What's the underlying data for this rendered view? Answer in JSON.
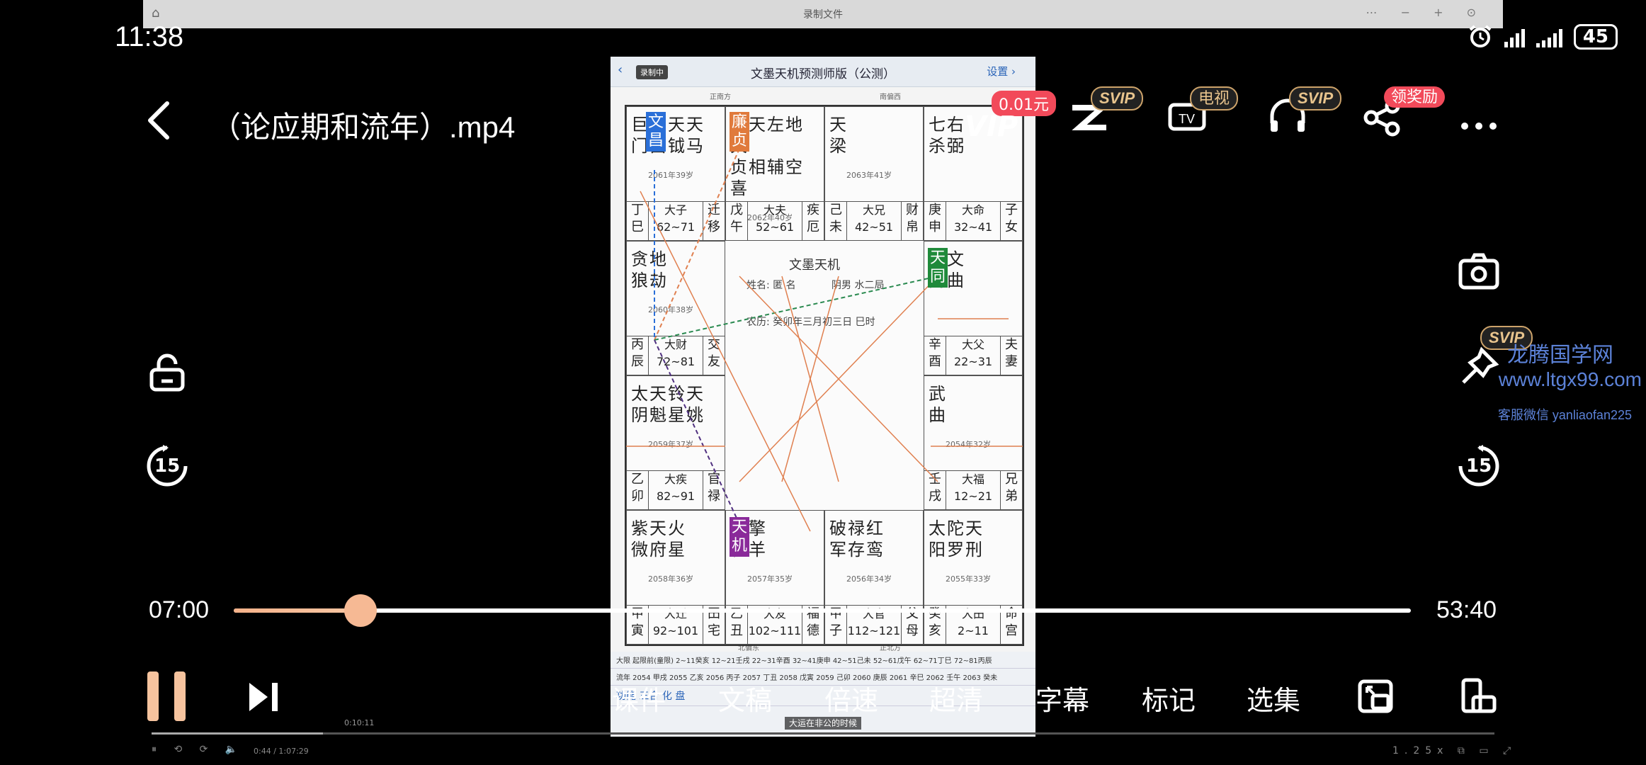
{
  "recorder": {
    "title": "录制文件",
    "home_icon": "⌂",
    "controls": "⋯ − + ⊙",
    "mini_time": "0:10:11",
    "bottom_left": "⏸ ⟲ ⟳ 🔈",
    "bottom_time": "0:44 / 1:07:29",
    "bottom_right": "1.25x ⧉ ▭ ⤢"
  },
  "status_bar": {
    "time": "11:38",
    "battery": "45"
  },
  "header": {
    "title": "（论应期和流年）.mp4"
  },
  "top_actions": {
    "price_badge": "0.01元",
    "vip_text": "VIP",
    "items": [
      {
        "name": "z-button",
        "badge": "SVIP"
      },
      {
        "name": "tv-button",
        "badge": "电视"
      },
      {
        "name": "audio-button",
        "badge": "SVIP"
      },
      {
        "name": "share-button",
        "badge": "领奖励"
      },
      {
        "name": "more-button",
        "badge": ""
      }
    ]
  },
  "side_controls": {
    "left_skip": "15",
    "right_skip": "15",
    "pin_badge": "SVIP"
  },
  "watermark": {
    "line1": "龙腾国学网",
    "line2": "www.ltgx99.com",
    "line3": "客服微信 yanliaofan225"
  },
  "player": {
    "current_time": "07:00",
    "total_time": "53:40",
    "progress": 0.108
  },
  "bottom_bar": {
    "items": [
      "课件",
      "文稿",
      "倍速",
      "超清",
      "字幕",
      "标记",
      "选集"
    ]
  },
  "video": {
    "back": "‹",
    "rec_tag": "录制中",
    "title": "文墨天机预测师版（公测）",
    "settings": "设置 ›",
    "center_title": "文墨天机",
    "center_name": "姓名: 匿 名",
    "center_gender": "阴男 水二局",
    "center_date": "农历: 癸卯年三月初三日 巳时",
    "top_dirs": [
      "正南方",
      "南偏西"
    ],
    "bottom_dirs": [
      "北偏东",
      "正北方"
    ],
    "palaces": [
      {
        "stars": "巨文天天",
        "stars2": "门昌钺马",
        "age": "2061年39岁",
        "cells": [
          "丁巳",
          "大子 62~71",
          "迁移"
        ]
      },
      {
        "stars": "廉天左地天",
        "stars2": "贞相辅空喜",
        "age": "2062年40岁",
        "cells": [
          "戊午",
          "大夫 52~61",
          "疾厄"
        ]
      },
      {
        "stars": "天",
        "stars2": "梁",
        "age": "2063年41岁",
        "cells": [
          "己未",
          "大兄 42~51",
          "财帛"
        ]
      },
      {
        "stars": "七右",
        "stars2": "杀弼",
        "age": "",
        "cells": [
          "庚申",
          "大命 32~41",
          "子女"
        ]
      },
      {
        "stars": "贪地",
        "stars2": "狼劫",
        "age": "2060年38岁",
        "cells": [
          "丙辰",
          "大财 72~81",
          "交友"
        ]
      },
      {
        "stars": "天文",
        "stars2": "同曲",
        "age": "",
        "cells": [
          "辛酉",
          "大父 22~31",
          "夫妻"
        ]
      },
      {
        "stars": "太天铃天",
        "stars2": "阴魁星姚",
        "age": "2059年37岁",
        "cells": [
          "乙卯",
          "大疾 82~91",
          "官禄"
        ]
      },
      {
        "stars": "武",
        "stars2": "曲",
        "age": "2054年32岁",
        "cells": [
          "壬戌",
          "大福 12~21",
          "兄弟"
        ]
      },
      {
        "stars": "紫天火",
        "stars2": "微府星",
        "age": "2058年36岁",
        "cells": [
          "甲寅",
          "大迁 92~101",
          "田宅"
        ]
      },
      {
        "stars": "天擎",
        "stars2": "机羊",
        "age": "2057年35岁",
        "cells": [
          "乙丑",
          "大友 102~111",
          "福德"
        ]
      },
      {
        "stars": "破禄红",
        "stars2": "军存鸾",
        "age": "2056年34岁",
        "cells": [
          "甲子",
          "大官 112~121",
          "父母"
        ]
      },
      {
        "stars": "太陀天",
        "stars2": "阳罗刑",
        "age": "2055年33岁",
        "cells": [
          "癸亥",
          "大田 2~11",
          "命宫"
        ]
      }
    ],
    "footer_row1": "大限 起限前(童限) 2~11癸亥 12~21壬戌 22~31辛酉 32~41庚申 42~51己未 52~61戊午 62~71丁巳 72~81丙辰",
    "footer_row2": "流年 2054 甲戌 2055 乙亥 2056 丙子 2057 丁丑 2058 戊寅 2059 己卯 2060 庚辰 2061 辛巳 2062 壬午 2063 癸未",
    "footer_row3": "功能  三合  化  盘",
    "caption": "大运在非公的时候"
  },
  "colors": {
    "accent": "#f6b994",
    "red_badge": "#f24a5a",
    "watermark": "#5c82d8"
  }
}
